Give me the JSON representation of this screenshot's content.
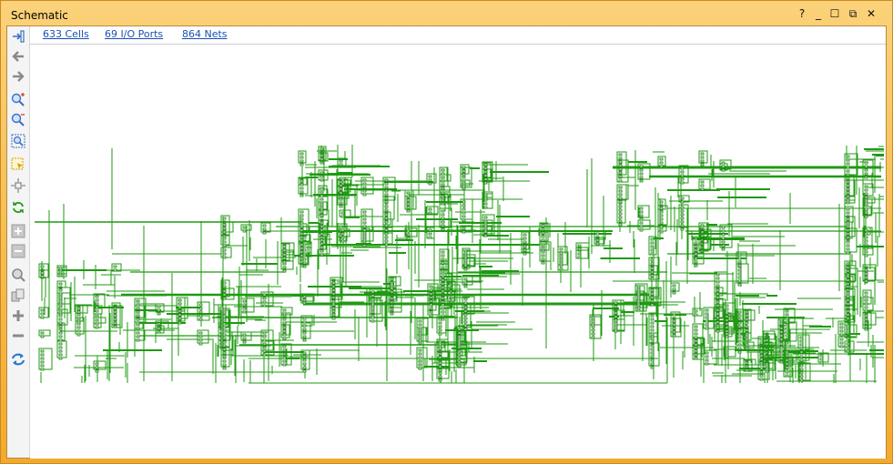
{
  "window": {
    "title": "Schematic",
    "help_label": "?",
    "minimize_label": "_",
    "maximize_label": "☐",
    "restore_label": "⧉",
    "close_label": "✕"
  },
  "stats_links": {
    "cells": "633 Cells",
    "ports": "69 I/O Ports",
    "nets": "864 Nets"
  },
  "toolbar": [
    {
      "name": "collapse-panel-icon"
    },
    {
      "name": "back-arrow-icon"
    },
    {
      "name": "forward-arrow-icon"
    },
    {
      "name": "zoom-in-icon"
    },
    {
      "name": "zoom-out-icon"
    },
    {
      "name": "zoom-fit-icon"
    },
    {
      "name": "select-area-icon"
    },
    {
      "name": "auto-fit-selection-icon"
    },
    {
      "name": "regenerate-icon"
    },
    {
      "name": "expand-all-icon"
    },
    {
      "name": "collapse-all-icon"
    },
    {
      "name": "search-icon"
    },
    {
      "name": "copy-icon"
    },
    {
      "name": "add-icon"
    },
    {
      "name": "remove-icon"
    },
    {
      "name": "refresh-icon"
    }
  ],
  "colors": {
    "wire": "#1f9a12",
    "wire_dark": "#147a0a",
    "accent_orange": "#f3a92e",
    "link_blue": "#1a4fb4",
    "icon_blue": "#3b6fc4",
    "icon_gray": "#8a8a8a"
  }
}
